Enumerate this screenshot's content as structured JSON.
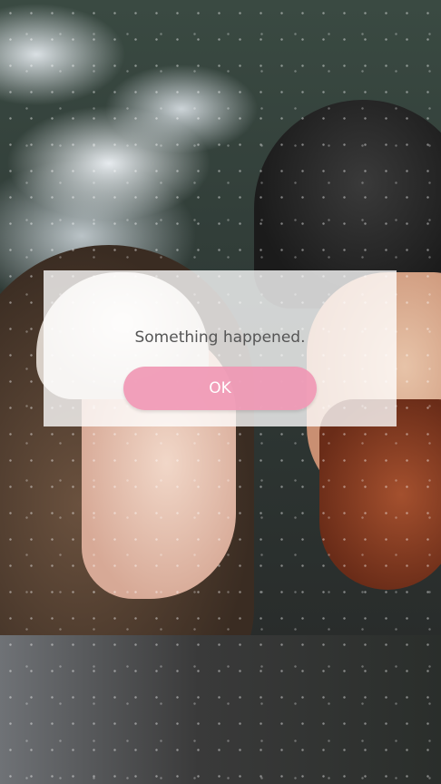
{
  "dialog": {
    "message": "Something happened.",
    "ok_label": "OK"
  },
  "colors": {
    "ok_button": "#f096b4",
    "dialog_background": "#ffffff",
    "message_text": "#555555"
  }
}
